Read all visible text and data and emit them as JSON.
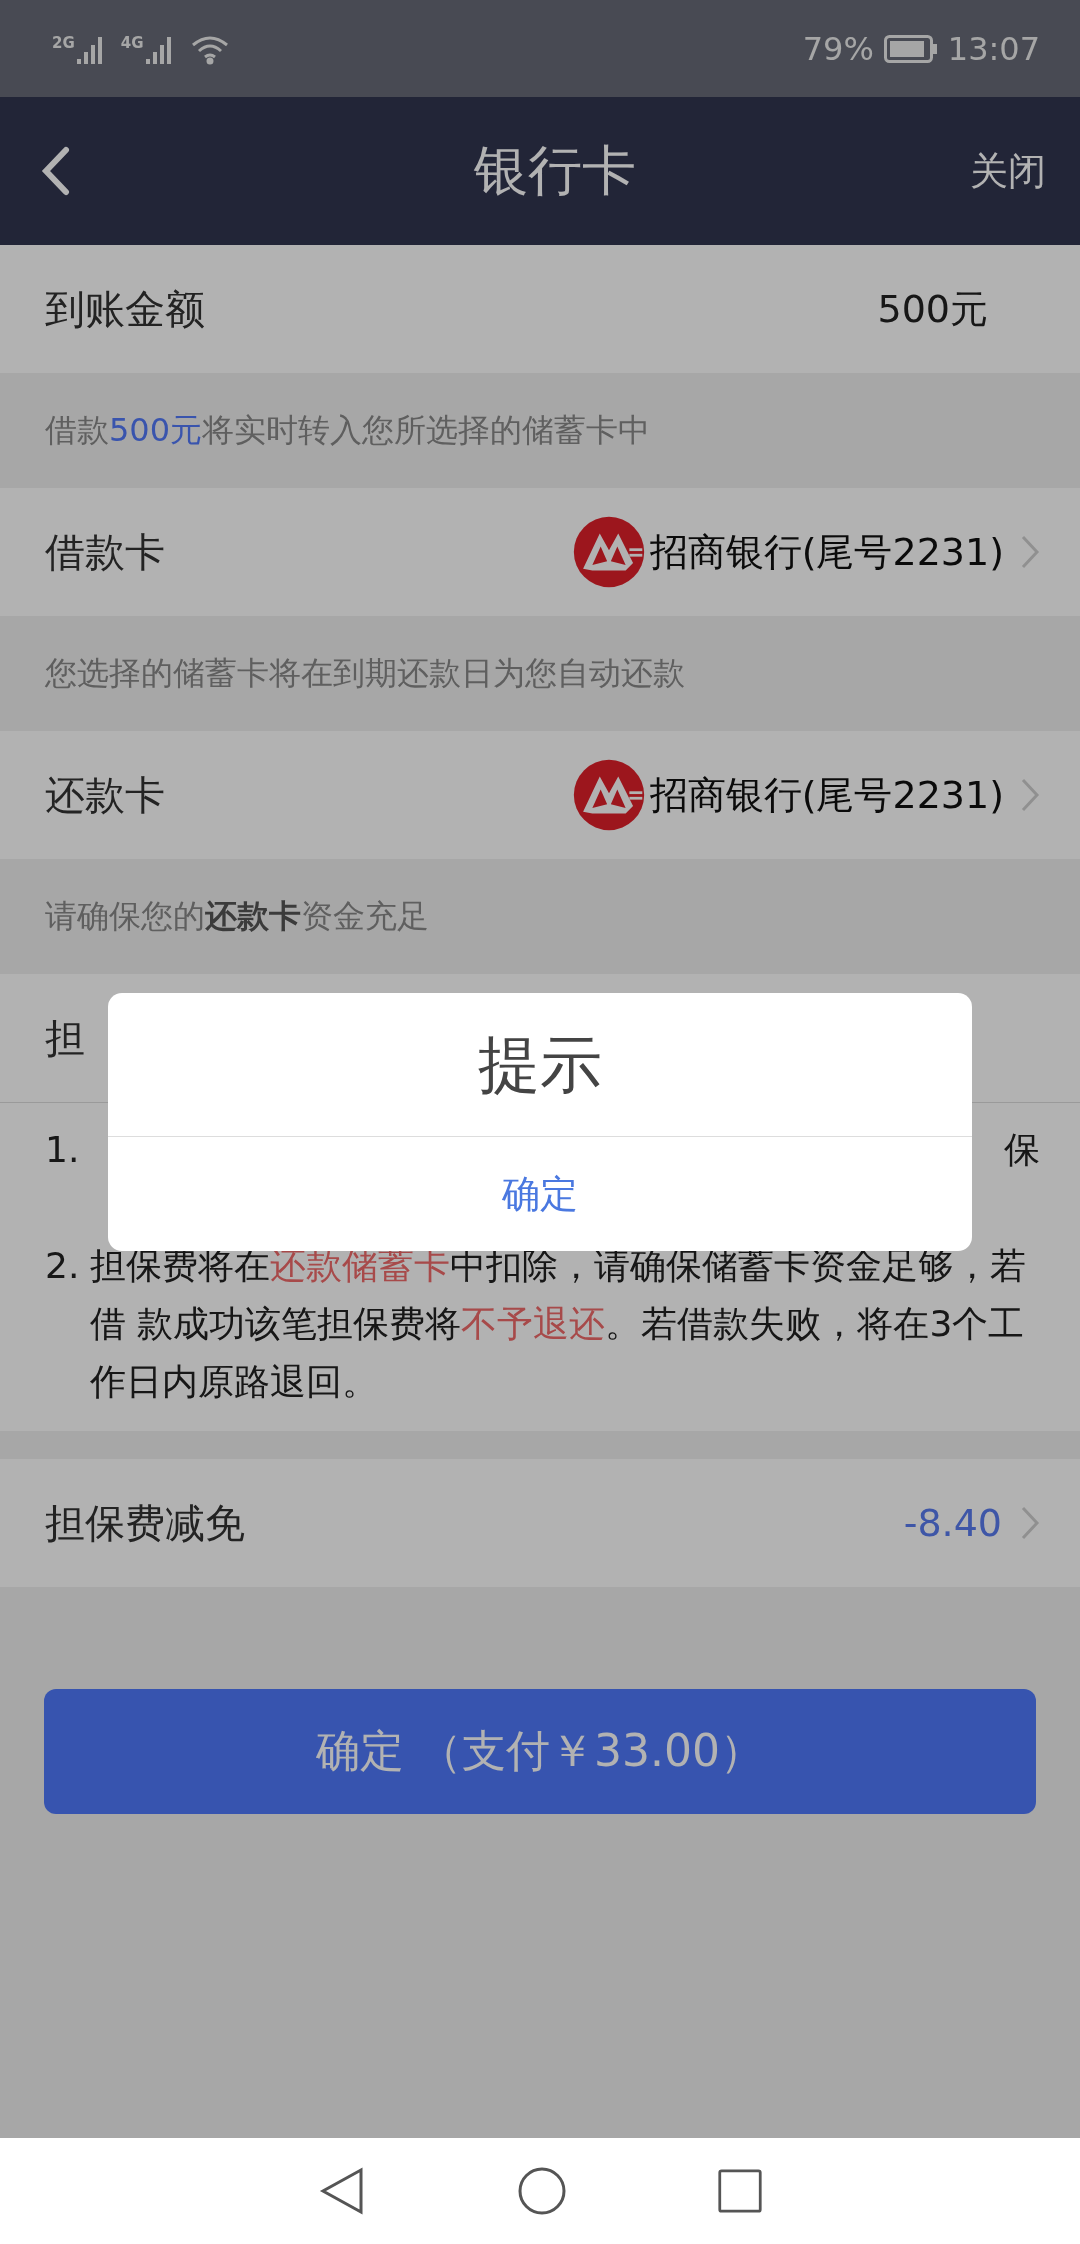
{
  "status_bar": {
    "signals": [
      "2G",
      "4G"
    ],
    "battery": "79%",
    "time": "13:07"
  },
  "nav": {
    "title": "银行卡",
    "close": "关闭"
  },
  "rows": [
    {
      "kind": "value",
      "label": "到账金额",
      "value": "500元"
    },
    {
      "kind": "hint",
      "parts": [
        {
          "kind": "plain",
          "text": "借款"
        },
        {
          "kind": "highlight",
          "text": "500元"
        },
        {
          "kind": "plain",
          "text": "将实时转入您所选择的储蓄卡中"
        }
      ]
    },
    {
      "kind": "card",
      "label": "借款卡",
      "bank": "招商银行(尾号2231)"
    },
    {
      "kind": "hint",
      "parts": [
        {
          "kind": "plain",
          "text": "您选择的储蓄卡将在到期还款日为您自动还款"
        }
      ]
    },
    {
      "kind": "card",
      "label": "还款卡",
      "bank": "招商银行(尾号2231)"
    },
    {
      "kind": "hint",
      "parts": [
        {
          "kind": "plain",
          "text": "请确保您的"
        },
        {
          "kind": "bold",
          "text": "还款卡"
        },
        {
          "kind": "plain",
          "text": "资金充足"
        }
      ]
    },
    {
      "kind": "value",
      "label": "担"
    }
  ],
  "notes": [
    {
      "number": "1.",
      "lines": [
        {
          "right": "保"
        }
      ]
    },
    {
      "number": "2.",
      "parts": [
        {
          "kind": "plain",
          "text": "担保费将在"
        },
        {
          "kind": "warning",
          "text": "还款储蓄卡"
        },
        {
          "kind": "plain",
          "text": "中扣除，请确保储蓄卡资金足够，若借 款成功该笔担保费将"
        },
        {
          "kind": "warning",
          "text": "不予退还"
        },
        {
          "kind": "plain",
          "text": "。若借款失败，将在3个工作日内原路退回。"
        }
      ]
    }
  ],
  "discount": {
    "label": "担保费减免",
    "value": "-8.40"
  },
  "submit": "确定 （支付￥33.00）",
  "dialog": {
    "title": "提示",
    "button": "确定"
  }
}
